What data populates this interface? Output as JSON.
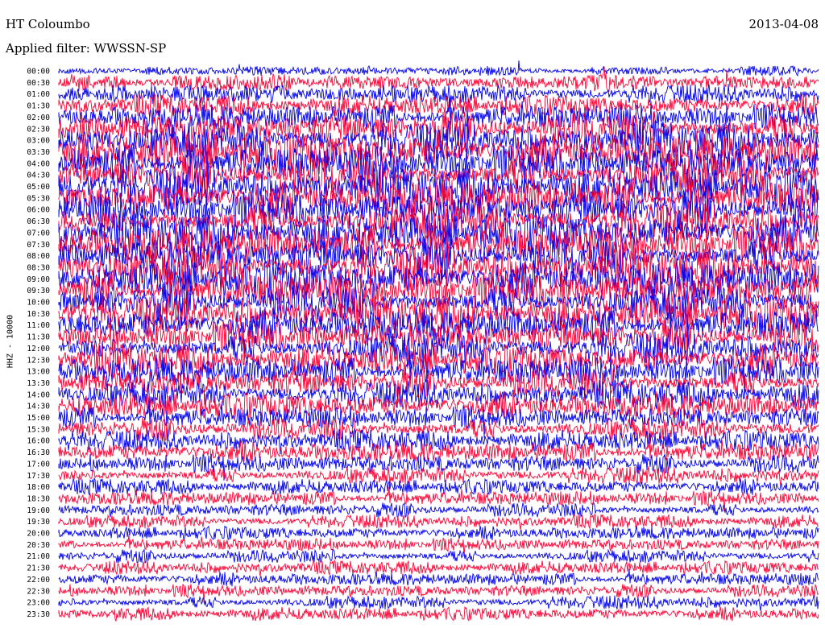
{
  "header": {
    "station": "HT Coloumbo",
    "date": "2013-04-08",
    "filter": "Applied filter: WWSSN-SP"
  },
  "chart_data": {
    "type": "line",
    "title": "HT Coloumbo",
    "ylabel": "HHZ - 10000",
    "trace_colors": [
      "#0000ee",
      "#ff0033"
    ],
    "row_labels": [
      "00:00",
      "00:30",
      "01:00",
      "01:30",
      "02:00",
      "02:30",
      "03:00",
      "03:30",
      "04:00",
      "04:30",
      "05:00",
      "05:30",
      "06:00",
      "06:30",
      "07:00",
      "07:30",
      "08:00",
      "08:30",
      "09:00",
      "09:30",
      "10:00",
      "10:30",
      "11:00",
      "11:30",
      "12:00",
      "12:30",
      "13:00",
      "13:30",
      "14:00",
      "14:30",
      "15:00",
      "15:30",
      "16:00",
      "16:30",
      "17:00",
      "17:30",
      "18:00",
      "18:30",
      "19:00",
      "19:30",
      "20:00",
      "20:30",
      "21:00",
      "21:30",
      "22:00",
      "22:30",
      "23:00",
      "23:30"
    ],
    "row_amplitude": [
      0.25,
      0.45,
      0.5,
      0.55,
      0.7,
      0.9,
      0.95,
      1.0,
      1.0,
      1.0,
      1.0,
      1.0,
      1.0,
      1.0,
      1.0,
      1.0,
      1.0,
      1.0,
      1.0,
      1.0,
      0.95,
      0.9,
      0.9,
      0.85,
      0.85,
      0.8,
      0.8,
      0.75,
      0.7,
      0.7,
      0.6,
      0.6,
      0.55,
      0.55,
      0.5,
      0.45,
      0.4,
      0.4,
      0.38,
      0.35,
      0.35,
      0.35,
      0.35,
      0.35,
      0.35,
      0.35,
      0.35,
      0.35
    ]
  }
}
